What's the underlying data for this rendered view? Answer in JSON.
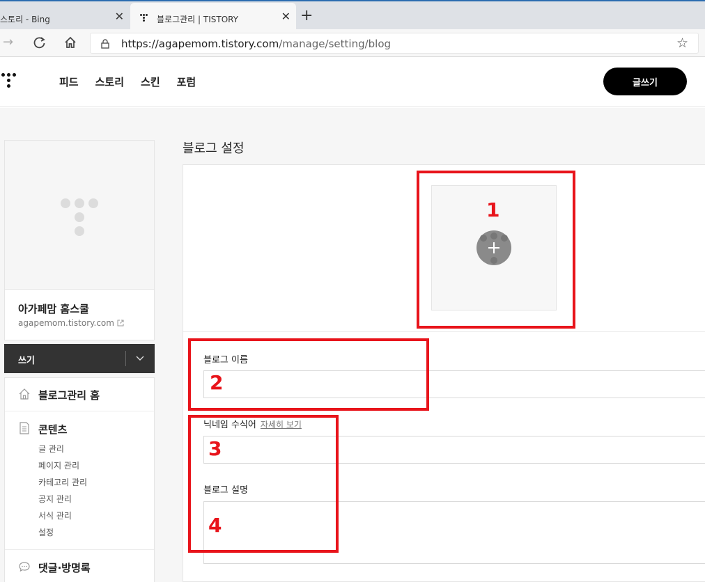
{
  "browser": {
    "tabs": [
      {
        "title": "스토리 - Bing",
        "close": "✕"
      },
      {
        "title": "블로그관리 | TISTORY",
        "close": "✕"
      }
    ],
    "new_tab": "+",
    "url_host": "https://agapemom.tistory.com",
    "url_path": "/manage/setting/blog"
  },
  "header": {
    "nav": [
      "피드",
      "스토리",
      "스킨",
      "포럼"
    ],
    "write_button": "글쓰기"
  },
  "sidebar": {
    "blog_name": "아가페맘 홈스쿨",
    "blog_url": "agapemom.tistory.com",
    "write_label": "쓰기",
    "home_label": "블로그관리 홈",
    "content_section": {
      "title": "콘텐츠",
      "items": [
        "글 관리",
        "페이지 관리",
        "카테고리 관리",
        "공지 관리",
        "서식 관리",
        "설정"
      ]
    },
    "comments_section": {
      "title": "댓글·방명록"
    }
  },
  "main": {
    "page_title": "블로그 설정",
    "fields": {
      "blog_name_label": "블로그 이름",
      "nickname_label": "닉네임 수식어",
      "nickname_link": "자세히 보기",
      "description_label": "블로그 설명"
    }
  },
  "annotations": [
    "1",
    "2",
    "3",
    "4"
  ],
  "colors": {
    "annotation": "#e8141b",
    "write_button_bg": "#000000",
    "sidebar_write_bg": "#333333"
  }
}
